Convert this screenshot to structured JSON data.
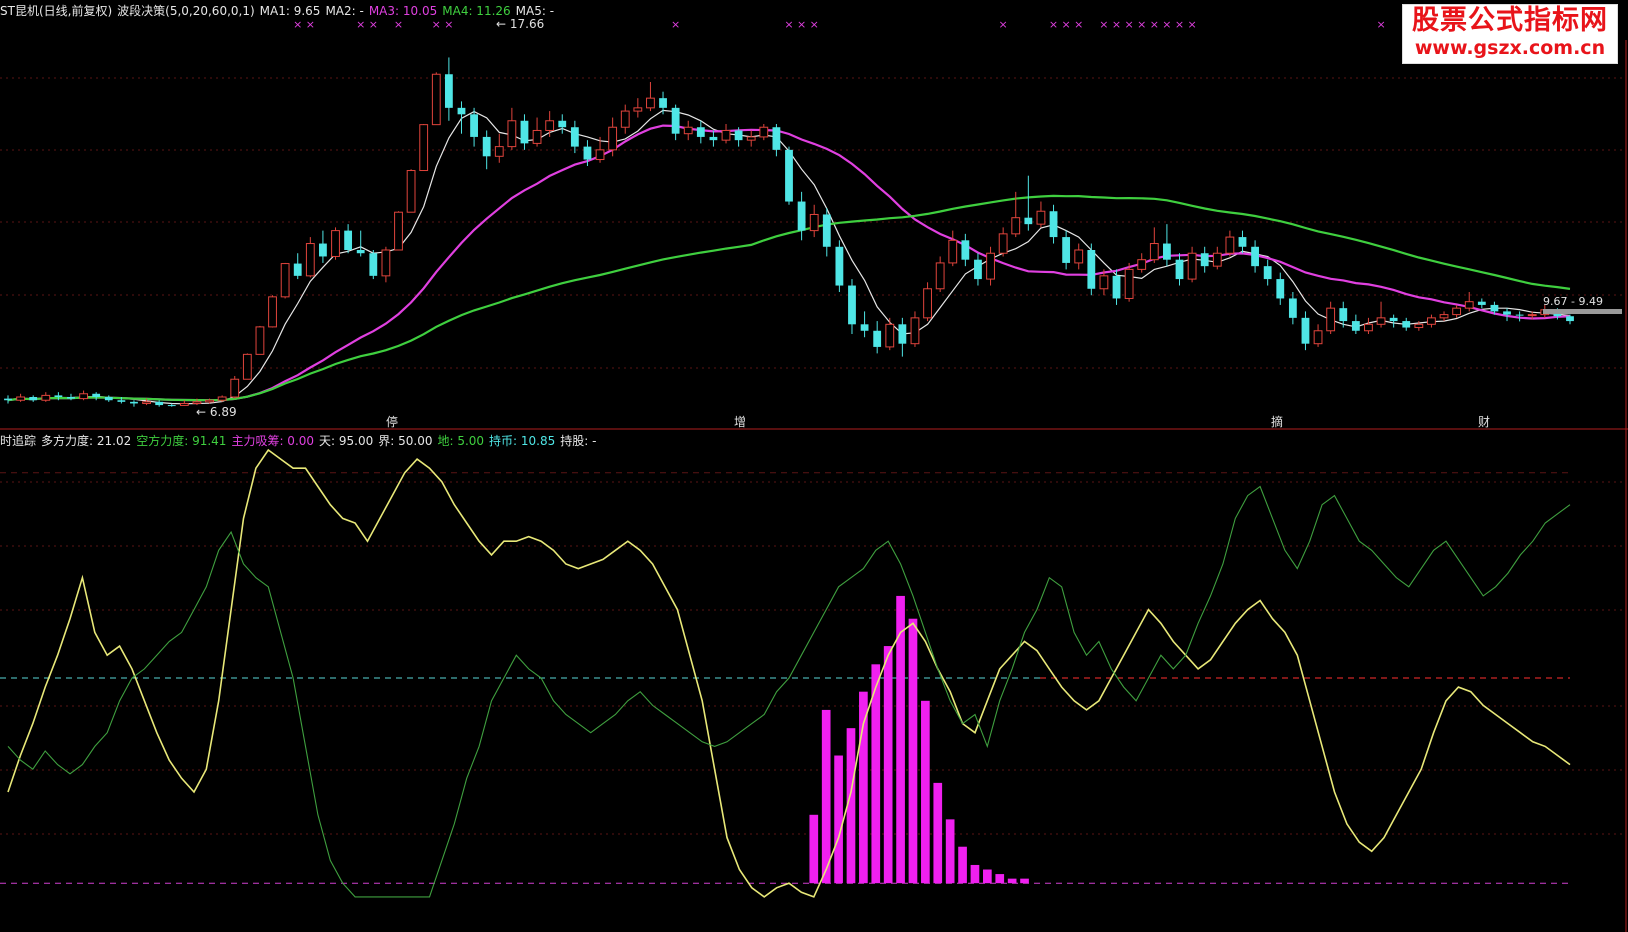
{
  "header_top": {
    "title": "ST昆机(日线,前复权)",
    "indicator": "波段决策(5,0,20,60,0,1)",
    "ma1": "MA1: 9.65",
    "ma2": "MA2: -",
    "ma3": "MA3: 10.05",
    "ma4": "MA4: 11.26",
    "ma5": "MA5: -"
  },
  "header_bottom": {
    "title": "时追踪",
    "duo": "多方力度: 21.02",
    "kong": "空方力度: 91.41",
    "zhuli": "主力吸筹: 0.00",
    "tian": "天: 95.00",
    "jie": "界: 50.00",
    "di": "地: 5.00",
    "chibi": "持币: 10.85",
    "chigu": "持股: -"
  },
  "logo": {
    "line1": "股票公式指标网",
    "line2": "www.gszx.com.cn"
  },
  "annotations": {
    "high": "17.66",
    "low": "6.89",
    "last_range": "9.67 - 9.49"
  },
  "events": [
    {
      "label": "停",
      "x": 392
    },
    {
      "label": "增",
      "x": 740
    },
    {
      "label": "摘",
      "x": 1277
    },
    {
      "label": "财",
      "x": 1484
    }
  ],
  "colors": {
    "up": "#e0443c",
    "down": "#4fe6e6",
    "ma5": "#e6e6e6",
    "ma20": "#e040e0",
    "ma60": "#3fcf3f",
    "duo": "#e8e878",
    "kong": "#3f9f3f",
    "zhuli": "#f020f0"
  },
  "chart_data": [
    {
      "type": "candlestick",
      "series": [
        {
          "name": "MA1",
          "ma_period": 5
        },
        {
          "name": "MA3",
          "ma_period": 20
        },
        {
          "name": "MA4",
          "ma_period": 60
        }
      ],
      "candles": [
        [
          7.1,
          7.05,
          7.2,
          6.95
        ],
        [
          7.05,
          7.15,
          7.25,
          7.0
        ],
        [
          7.15,
          7.05,
          7.2,
          7.0
        ],
        [
          7.05,
          7.2,
          7.3,
          7.0
        ],
        [
          7.2,
          7.15,
          7.3,
          7.05
        ],
        [
          7.15,
          7.1,
          7.25,
          7.05
        ],
        [
          7.1,
          7.25,
          7.35,
          7.05
        ],
        [
          7.25,
          7.15,
          7.3,
          7.05
        ],
        [
          7.15,
          7.05,
          7.2,
          7.0
        ],
        [
          7.05,
          7.0,
          7.15,
          6.95
        ],
        [
          7.0,
          6.95,
          7.05,
          6.85
        ],
        [
          6.95,
          7.0,
          7.1,
          6.9
        ],
        [
          7.0,
          6.9,
          7.05,
          6.85
        ],
        [
          6.9,
          6.89,
          6.95,
          6.85
        ],
        [
          6.89,
          6.95,
          7.05,
          6.88
        ],
        [
          6.95,
          7.0,
          7.1,
          6.9
        ],
        [
          7.0,
          7.05,
          7.1,
          6.95
        ],
        [
          7.05,
          7.15,
          7.2,
          7.0
        ],
        [
          7.15,
          7.7,
          7.8,
          7.1
        ],
        [
          7.7,
          8.47,
          8.5,
          7.7
        ],
        [
          8.47,
          9.32,
          9.35,
          8.47
        ],
        [
          9.32,
          10.25,
          10.3,
          9.3
        ],
        [
          10.25,
          11.28,
          11.3,
          10.2
        ],
        [
          11.28,
          10.9,
          11.6,
          10.8
        ],
        [
          10.9,
          11.9,
          12.1,
          10.85
        ],
        [
          11.9,
          11.5,
          12.3,
          11.3
        ],
        [
          11.5,
          12.3,
          12.4,
          11.4
        ],
        [
          12.3,
          11.7,
          12.5,
          11.6
        ],
        [
          11.7,
          11.6,
          12.3,
          11.5
        ],
        [
          11.6,
          10.9,
          11.7,
          10.8
        ],
        [
          10.9,
          11.7,
          11.8,
          10.7
        ],
        [
          11.7,
          12.87,
          12.9,
          11.7
        ],
        [
          12.87,
          14.16,
          14.2,
          12.87
        ],
        [
          14.16,
          15.58,
          15.6,
          14.16
        ],
        [
          15.58,
          17.14,
          17.2,
          15.58
        ],
        [
          17.14,
          16.1,
          17.66,
          15.7
        ],
        [
          16.1,
          15.9,
          16.3,
          15.3
        ],
        [
          15.9,
          15.2,
          16.1,
          14.9
        ],
        [
          15.2,
          14.6,
          15.4,
          14.2
        ],
        [
          14.6,
          14.9,
          15.3,
          14.4
        ],
        [
          14.9,
          15.7,
          16.1,
          14.8
        ],
        [
          15.7,
          15.0,
          15.9,
          14.8
        ],
        [
          15.0,
          15.4,
          15.8,
          14.9
        ],
        [
          15.4,
          15.7,
          16.0,
          15.2
        ],
        [
          15.7,
          15.5,
          15.9,
          15.3
        ],
        [
          15.5,
          14.9,
          15.7,
          14.7
        ],
        [
          14.9,
          14.5,
          15.1,
          14.3
        ],
        [
          14.5,
          14.8,
          15.2,
          14.4
        ],
        [
          14.8,
          15.5,
          15.8,
          14.6
        ],
        [
          15.5,
          16.0,
          16.2,
          15.3
        ],
        [
          16.0,
          16.1,
          16.4,
          15.8
        ],
        [
          16.1,
          16.4,
          16.9,
          16.0
        ],
        [
          16.4,
          16.1,
          16.6,
          15.9
        ],
        [
          16.1,
          15.3,
          16.2,
          15.1
        ],
        [
          15.3,
          15.5,
          15.7,
          15.1
        ],
        [
          15.5,
          15.2,
          15.7,
          15.0
        ],
        [
          15.2,
          15.1,
          15.4,
          14.9
        ],
        [
          15.1,
          15.4,
          15.6,
          15.0
        ],
        [
          15.4,
          15.1,
          15.5,
          14.9
        ],
        [
          15.1,
          15.2,
          15.4,
          14.9
        ],
        [
          15.2,
          15.5,
          15.6,
          15.1
        ],
        [
          15.5,
          14.8,
          15.6,
          14.6
        ],
        [
          14.8,
          13.2,
          14.9,
          13.1
        ],
        [
          13.2,
          12.3,
          13.5,
          12.0
        ],
        [
          12.3,
          12.8,
          13.1,
          12.1
        ],
        [
          12.8,
          11.8,
          13.0,
          11.5
        ],
        [
          11.8,
          10.6,
          12.0,
          10.4
        ],
        [
          10.6,
          9.4,
          10.8,
          9.1
        ],
        [
          9.4,
          9.2,
          9.8,
          9.0
        ],
        [
          9.2,
          8.7,
          9.5,
          8.5
        ],
        [
          8.7,
          9.4,
          9.6,
          8.6
        ],
        [
          9.4,
          8.8,
          9.6,
          8.4
        ],
        [
          8.8,
          9.6,
          9.8,
          8.7
        ],
        [
          9.6,
          10.5,
          10.7,
          9.5
        ],
        [
          10.5,
          11.3,
          11.5,
          10.4
        ],
        [
          11.3,
          12.0,
          12.3,
          11.2
        ],
        [
          12.0,
          11.4,
          12.2,
          11.2
        ],
        [
          11.4,
          10.8,
          11.6,
          10.6
        ],
        [
          10.8,
          11.6,
          11.8,
          10.6
        ],
        [
          11.6,
          12.2,
          12.4,
          11.5
        ],
        [
          12.2,
          12.7,
          13.5,
          12.1
        ],
        [
          12.7,
          12.5,
          14.0,
          12.3
        ],
        [
          12.5,
          12.9,
          13.2,
          12.4
        ],
        [
          12.9,
          12.1,
          13.1,
          11.9
        ],
        [
          12.1,
          11.3,
          12.3,
          11.1
        ],
        [
          11.3,
          11.7,
          11.9,
          11.1
        ],
        [
          11.7,
          10.5,
          11.9,
          10.3
        ],
        [
          10.5,
          10.9,
          11.1,
          10.3
        ],
        [
          10.9,
          10.2,
          11.1,
          10.0
        ],
        [
          10.2,
          11.1,
          11.3,
          10.1
        ],
        [
          11.1,
          11.4,
          11.6,
          11.0
        ],
        [
          11.4,
          11.9,
          12.4,
          11.3
        ],
        [
          11.9,
          11.4,
          12.5,
          11.2
        ],
        [
          11.4,
          10.8,
          11.6,
          10.6
        ],
        [
          10.8,
          11.6,
          11.8,
          10.7
        ],
        [
          11.6,
          11.2,
          11.8,
          11.0
        ],
        [
          11.2,
          11.6,
          11.8,
          11.1
        ],
        [
          11.6,
          12.1,
          12.3,
          11.5
        ],
        [
          12.1,
          11.8,
          12.3,
          11.6
        ],
        [
          11.8,
          11.2,
          12.0,
          11.0
        ],
        [
          11.2,
          10.8,
          11.4,
          10.6
        ],
        [
          10.8,
          10.2,
          11.0,
          10.0
        ],
        [
          10.2,
          9.6,
          10.4,
          9.4
        ],
        [
          9.6,
          8.8,
          9.8,
          8.6
        ],
        [
          8.8,
          9.2,
          9.4,
          8.7
        ],
        [
          9.2,
          9.9,
          10.1,
          9.1
        ],
        [
          9.9,
          9.5,
          10.1,
          9.3
        ],
        [
          9.5,
          9.2,
          9.7,
          9.1
        ],
        [
          9.2,
          9.4,
          9.6,
          9.1
        ],
        [
          9.4,
          9.6,
          10.1,
          9.3
        ],
        [
          9.6,
          9.5,
          9.7,
          9.3
        ],
        [
          9.5,
          9.3,
          9.6,
          9.2
        ],
        [
          9.3,
          9.4,
          9.5,
          9.2
        ],
        [
          9.4,
          9.6,
          9.7,
          9.3
        ],
        [
          9.6,
          9.7,
          9.8,
          9.5
        ],
        [
          9.7,
          9.9,
          10.0,
          9.6
        ],
        [
          9.9,
          10.1,
          10.4,
          9.8
        ],
        [
          10.1,
          10.0,
          10.2,
          9.9
        ],
        [
          10.0,
          9.8,
          10.1,
          9.7
        ],
        [
          9.8,
          9.7,
          9.9,
          9.5
        ],
        [
          9.7,
          9.67,
          9.8,
          9.49
        ],
        [
          9.67,
          9.7,
          9.8,
          9.55
        ],
        [
          9.7,
          9.85,
          10.0,
          9.6
        ],
        [
          9.85,
          9.65,
          9.9,
          9.55
        ],
        [
          9.65,
          9.5,
          9.7,
          9.4
        ]
      ],
      "ylim": [
        6.5,
        18.2
      ]
    },
    {
      "type": "line",
      "series": [
        {
          "name": "多方力度",
          "values": [
            25,
            33,
            40,
            48,
            55,
            63,
            72,
            60,
            55,
            57,
            52,
            45,
            38,
            32,
            28,
            25,
            30,
            45,
            65,
            85,
            96,
            100,
            98,
            96,
            96,
            92,
            88,
            85,
            84,
            80,
            85,
            90,
            95,
            98,
            96,
            93,
            88,
            84,
            80,
            77,
            80,
            80,
            81,
            80,
            78,
            75,
            74,
            75,
            76,
            78,
            80,
            78,
            75,
            70,
            65,
            55,
            45,
            30,
            15,
            8,
            4,
            2,
            4,
            5,
            3,
            2,
            8,
            15,
            25,
            40,
            48,
            55,
            60,
            62,
            58,
            52,
            47,
            40,
            38,
            45,
            52,
            55,
            58,
            56,
            52,
            48,
            45,
            43,
            45,
            50,
            55,
            60,
            65,
            62,
            58,
            55,
            52,
            54,
            58,
            62,
            65,
            67,
            63,
            60,
            55,
            45,
            35,
            25,
            18,
            14,
            12,
            15,
            20,
            25,
            30,
            38,
            45,
            48,
            47,
            44,
            42,
            40,
            38,
            36,
            35,
            33,
            31
          ]
        },
        {
          "name": "空方力度",
          "values": [
            35,
            32,
            30,
            34,
            31,
            29,
            31,
            35,
            38,
            45,
            50,
            52,
            55,
            58,
            60,
            65,
            70,
            78,
            82,
            75,
            72,
            70,
            60,
            50,
            35,
            20,
            10,
            5,
            2,
            2,
            2,
            2,
            2,
            2,
            2,
            10,
            18,
            28,
            35,
            45,
            50,
            55,
            52,
            50,
            45,
            42,
            40,
            38,
            40,
            42,
            45,
            47,
            44,
            42,
            40,
            38,
            36,
            35,
            36,
            38,
            40,
            42,
            47,
            50,
            55,
            60,
            65,
            70,
            72,
            74,
            78,
            80,
            75,
            68,
            60,
            52,
            45,
            40,
            42,
            35,
            45,
            52,
            60,
            65,
            72,
            70,
            60,
            55,
            58,
            52,
            48,
            45,
            50,
            55,
            52,
            55,
            62,
            68,
            75,
            85,
            90,
            92,
            85,
            78,
            74,
            80,
            88,
            90,
            85,
            80,
            78,
            75,
            72,
            70,
            74,
            78,
            80,
            76,
            72,
            68,
            70,
            73,
            77,
            80,
            84,
            86,
            88
          ]
        },
        {
          "name": "主力吸筹",
          "values": [
            0,
            0,
            0,
            0,
            0,
            0,
            0,
            0,
            0,
            0,
            0,
            0,
            0,
            0,
            0,
            0,
            0,
            0,
            0,
            0,
            0,
            0,
            0,
            0,
            0,
            0,
            0,
            0,
            0,
            0,
            0,
            0,
            0,
            0,
            0,
            0,
            0,
            0,
            0,
            0,
            0,
            0,
            0,
            0,
            0,
            0,
            0,
            0,
            0,
            0,
            0,
            0,
            0,
            0,
            0,
            0,
            0,
            0,
            0,
            0,
            0,
            0,
            0,
            0,
            0,
            15,
            38,
            28,
            34,
            42,
            48,
            52,
            63,
            58,
            40,
            22,
            14,
            8,
            4,
            3,
            2,
            1,
            1,
            0,
            0,
            0,
            0,
            0,
            0,
            0,
            0,
            0,
            0,
            0,
            0,
            0,
            0,
            0,
            0,
            0,
            0,
            0,
            0,
            0,
            0,
            0,
            0,
            0,
            0,
            0,
            0,
            0,
            0,
            0,
            0,
            0,
            0,
            0,
            0,
            0,
            0,
            0,
            0,
            0,
            0,
            0,
            0
          ]
        }
      ],
      "ylim": [
        0,
        100
      ],
      "reference_lines": [
        95,
        50,
        5
      ]
    }
  ]
}
